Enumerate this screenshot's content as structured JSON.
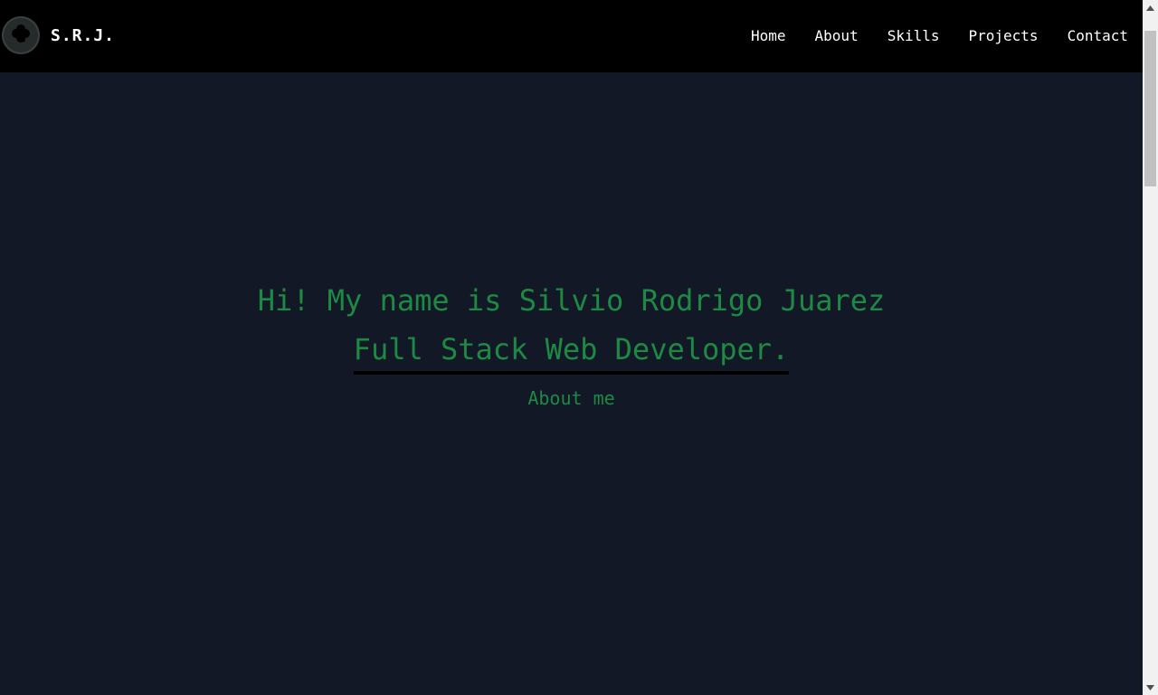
{
  "navbar": {
    "logo_icon": "clover-icon",
    "brand": "S.R.J.",
    "links": [
      {
        "label": "Home"
      },
      {
        "label": "About"
      },
      {
        "label": "Skills"
      },
      {
        "label": "Projects"
      },
      {
        "label": "Contact"
      }
    ]
  },
  "hero": {
    "greeting": "Hi! My name is Silvio Rodrigo Juarez",
    "role": "Full Stack Web Developer.",
    "about_button": "About me"
  },
  "colors": {
    "background": "#131827",
    "navbar": "#000000",
    "accent_green": "#1c8a43",
    "nav_text": "#ffffff"
  }
}
